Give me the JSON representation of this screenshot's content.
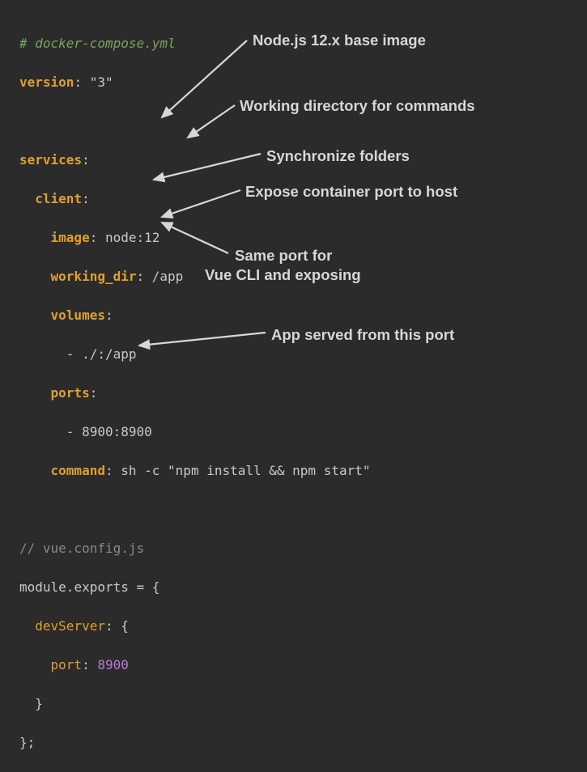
{
  "code": {
    "l1_comment": "# docker-compose.yml",
    "l2_key": "version",
    "l2_colon": ":",
    "l2_val": " \"3\"",
    "l4_key": "services",
    "l4_colon": ":",
    "l5_key": "client",
    "l5_colon": ":",
    "l6_key": "image",
    "l6_colon": ":",
    "l6_val": " node:12",
    "l7_key": "working_dir",
    "l7_colon": ":",
    "l7_val": " /app",
    "l8_key": "volumes",
    "l8_colon": ":",
    "l9_dash": "- ",
    "l9_val": "./:/app",
    "l10_key": "ports",
    "l10_colon": ":",
    "l11_dash": "- ",
    "l11_val": "8900:8900",
    "l12_key": "command",
    "l12_colon": ":",
    "l12_val": " sh -c \"npm install && npm start\"",
    "l14_comment": "// vue.config.js",
    "l15_a": "module",
    "l15_b": ".",
    "l15_c": "exports",
    "l15_d": " = {",
    "l16_key": "devServer",
    "l16_colon": ": {",
    "l17_key": "port",
    "l17_colon": ": ",
    "l17_val": "8900",
    "l18": "}",
    "l19": "};"
  },
  "annotations": {
    "a1": "Node.js 12.x base image",
    "a2": "Working directory for commands",
    "a3": "Synchronize folders",
    "a4": "Expose container port to host",
    "a5_line1": "Same port for",
    "a5_line2": "Vue CLI and exposing",
    "a6": "App served from this port"
  }
}
